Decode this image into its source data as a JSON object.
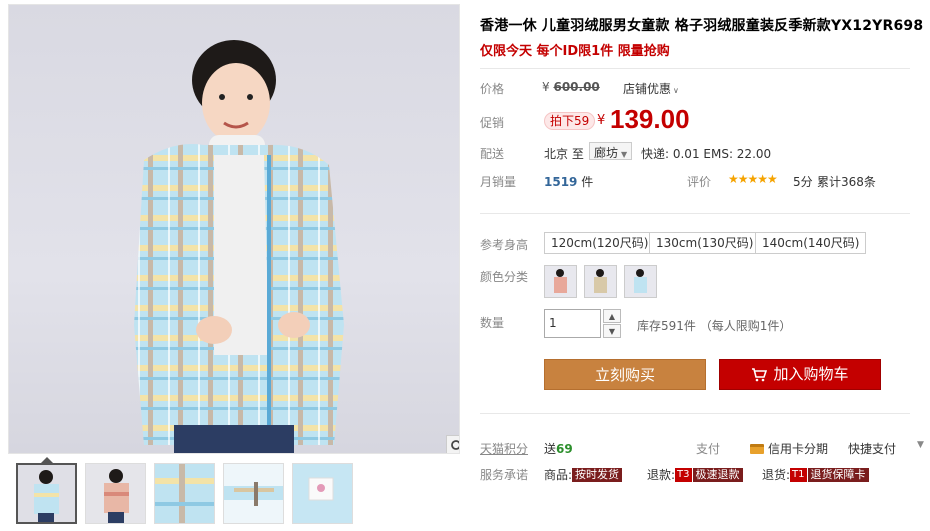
{
  "product": {
    "title": "香港一休 儿童羽绒服男女童款 格子羽绒服童装反季新款YX12YR698",
    "subtitle": "仅限今天 每个ID限1件 限量抢购"
  },
  "price": {
    "label": "价格",
    "currency": "¥",
    "original": "600.00",
    "shop_discount": "店铺优惠"
  },
  "promo": {
    "label": "促销",
    "badge": "拍下59",
    "currency": "¥",
    "price": "139.00"
  },
  "shipping": {
    "label": "配送",
    "from": "北京 至",
    "to": "廊坊",
    "cost": "快递: 0.01 EMS: 22.00"
  },
  "sales": {
    "label": "月销量",
    "count": "1519",
    "unit": "件"
  },
  "rating": {
    "label": "评价",
    "stars": "★★★★★",
    "score": "5分",
    "count": "累计368条"
  },
  "size": {
    "label": "参考身高",
    "options": [
      "120cm(120尺码)",
      "130cm(130尺码)",
      "140cm(140尺码)"
    ]
  },
  "color": {
    "label": "颜色分类"
  },
  "quantity": {
    "label": "数量",
    "value": "1",
    "stock": "库存591件 （每人限购1件）"
  },
  "actions": {
    "buy_now": "立刻购买",
    "add_to_cart": "加入购物车"
  },
  "tmall": {
    "points_label": "天猫积分",
    "points_prefix": "送",
    "points": "69",
    "pay_label": "支付",
    "credit": "信用卡分期",
    "quick_pay": "快捷支付"
  },
  "service": {
    "label": "服务承诺",
    "goods_label": "商品:",
    "goods_text": "按时发货",
    "refund_label": "退款:",
    "refund_tag": "T3",
    "refund_text": "极速退款",
    "return_label": "退货:",
    "return_tag": "T1",
    "return_text": "退货保障卡"
  },
  "colors": {
    "accent_red": "#c40000",
    "buy_orange": "#c8823f",
    "points_green": "#2c8f2c"
  }
}
